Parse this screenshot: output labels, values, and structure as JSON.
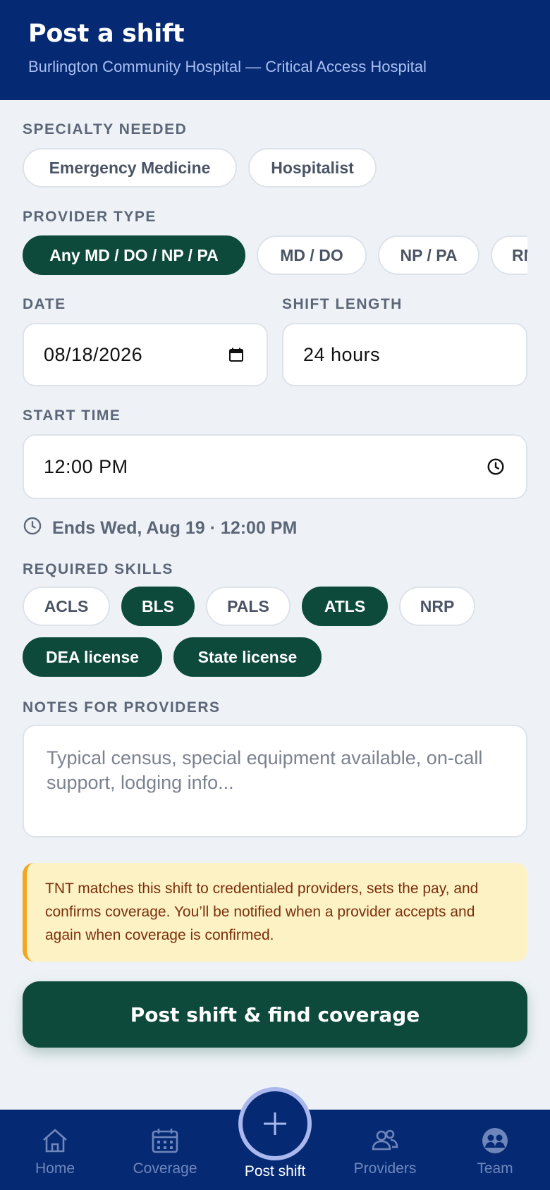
{
  "header": {
    "title": "Post a shift",
    "subtitle": "Burlington Community Hospital — Critical Access Hospital"
  },
  "specialty": {
    "label": "SPECIALTY NEEDED",
    "options": [
      "Emergency Medicine",
      "Hospitalist"
    ]
  },
  "provider_type": {
    "label": "PROVIDER TYPE",
    "options": [
      "Any MD / DO / NP / PA",
      "MD / DO",
      "NP / PA",
      "RN"
    ],
    "selected": "Any MD / DO / NP / PA"
  },
  "date": {
    "label": "DATE",
    "value": "08/18/2026"
  },
  "shift_length": {
    "label": "SHIFT LENGTH",
    "value": "24 hours"
  },
  "start_time": {
    "label": "START TIME",
    "value": "12:00 PM"
  },
  "ends_text": "Ends Wed, Aug 19 · 12:00 PM",
  "skills": {
    "label": "REQUIRED SKILLS",
    "items": [
      {
        "label": "ACLS",
        "selected": false
      },
      {
        "label": "BLS",
        "selected": true
      },
      {
        "label": "PALS",
        "selected": false
      },
      {
        "label": "ATLS",
        "selected": true
      },
      {
        "label": "NRP",
        "selected": false
      },
      {
        "label": "DEA license",
        "selected": true
      },
      {
        "label": "State license",
        "selected": true
      }
    ]
  },
  "notes": {
    "label": "NOTES FOR PROVIDERS",
    "placeholder": "Typical census, special equipment available, on-call support, lodging info..."
  },
  "info_text": "TNT matches this shift to credentialed providers, sets the pay, and confirms coverage. You’ll be notified when a provider accepts and again when coverage is confirmed.",
  "cta_label": "Post shift & find coverage",
  "tabs": {
    "home": "Home",
    "coverage": "Coverage",
    "post": "Post shift",
    "providers": "Providers",
    "team": "Team"
  },
  "colors": {
    "header_bg": "#052a73",
    "accent_green": "#0d4a3c",
    "warning_border": "#f2a71d",
    "warning_bg": "#fdf2c4"
  }
}
